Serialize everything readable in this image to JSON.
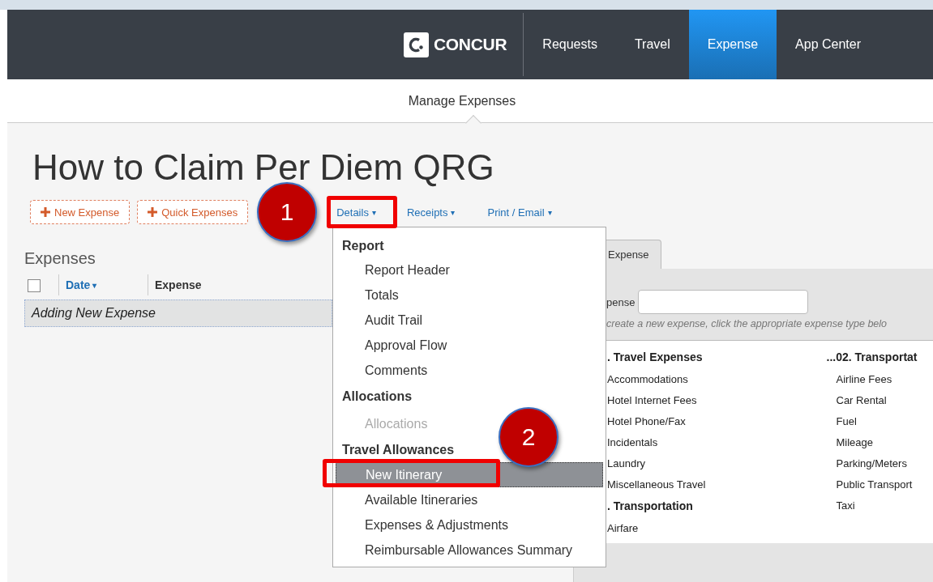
{
  "nav": {
    "logo": "CONCUR",
    "tabs": [
      {
        "label": "Requests",
        "selected": false
      },
      {
        "label": "Travel",
        "selected": false
      },
      {
        "label": "Expense",
        "selected": true
      },
      {
        "label": "App Center",
        "selected": false
      }
    ]
  },
  "subnav": {
    "label": "Manage Expenses"
  },
  "report": {
    "title": "How to Claim Per Diem QRG",
    "toolbar": [
      {
        "kind": "add",
        "label": "New Expense"
      },
      {
        "kind": "add",
        "label": "Quick Expenses"
      },
      {
        "kind": "menu",
        "label": "Details",
        "caret": "▾"
      },
      {
        "kind": "menu",
        "label": "Receipts",
        "caret": "▾"
      },
      {
        "kind": "menu",
        "label": "Print / Email",
        "caret": "▾"
      }
    ]
  },
  "expenses": {
    "heading": "Expenses",
    "select_all": {
      "checked": false
    },
    "columns": [
      {
        "label": "Date",
        "caret": "▾"
      },
      {
        "label": "Expense"
      }
    ],
    "rows": [
      {
        "text": "Adding New Expense",
        "selected": true
      }
    ]
  },
  "details_menu": {
    "sections": [
      {
        "heading": "Report",
        "items": [
          {
            "label": "Report Header",
            "disabled": false,
            "selected": false
          },
          {
            "label": "Totals",
            "disabled": false,
            "selected": false
          },
          {
            "label": "Audit Trail",
            "disabled": false,
            "selected": false
          },
          {
            "label": "Approval Flow",
            "disabled": false,
            "selected": false
          },
          {
            "label": "Comments",
            "disabled": false,
            "selected": false
          }
        ]
      },
      {
        "heading": "Allocations",
        "items": [
          {
            "label": "Allocations",
            "disabled": true,
            "selected": false
          }
        ]
      },
      {
        "heading": "Travel Allowances",
        "items": [
          {
            "label": "New Itinerary",
            "disabled": false,
            "selected": true
          },
          {
            "label": "Available Itineraries",
            "disabled": false,
            "selected": false
          },
          {
            "label": "Expenses & Adjustments",
            "disabled": false,
            "selected": false
          },
          {
            "label": "Reimbursable Allowances Summary",
            "disabled": false,
            "selected": false
          }
        ]
      }
    ]
  },
  "new_expense_panel": {
    "tab": {
      "label": "Expense",
      "selected": true
    },
    "field_label": "pense",
    "hint": "create a new expense, click the appropriate expense type belo",
    "columns": [
      {
        "groups": [
          {
            "heading": ". Travel Expenses",
            "items": [
              "Accommodations",
              "Hotel Internet Fees",
              "Hotel Phone/Fax",
              "Incidentals",
              "Laundry",
              "Miscellaneous Travel"
            ]
          },
          {
            "heading": ". Transportation",
            "items": [
              "Airfare"
            ]
          }
        ]
      },
      {
        "groups": [
          {
            "heading": "...02. Transportat",
            "items": [
              "Airline Fees",
              "Car Rental",
              "Fuel",
              "Mileage",
              "Parking/Meters",
              "Public Transport",
              "Taxi"
            ]
          }
        ]
      }
    ]
  },
  "callouts": [
    {
      "number": "1"
    },
    {
      "number": "2"
    }
  ]
}
